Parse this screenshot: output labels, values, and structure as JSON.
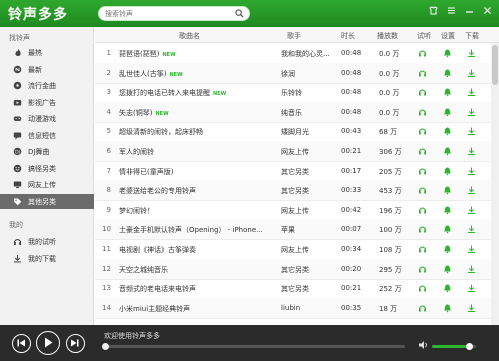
{
  "app": {
    "title": "铃声多多"
  },
  "search": {
    "placeholder": "搜索铃声"
  },
  "sidebar": {
    "section_find": "找铃声",
    "items": [
      {
        "label": "最热",
        "icon": "flame-icon"
      },
      {
        "label": "最新",
        "icon": "new-icon"
      },
      {
        "label": "流行金曲",
        "icon": "disc-icon"
      },
      {
        "label": "影视广告",
        "icon": "film-icon"
      },
      {
        "label": "动漫游戏",
        "icon": "gamepad-icon"
      },
      {
        "label": "信息短信",
        "icon": "message-icon"
      },
      {
        "label": "DJ舞曲",
        "icon": "dj-icon"
      },
      {
        "label": "搞怪另类",
        "icon": "funny-icon"
      },
      {
        "label": "网友上传",
        "icon": "upload-icon"
      },
      {
        "label": "其他另类",
        "icon": "tag-icon"
      }
    ],
    "active_index": 9,
    "section_mine": "我的",
    "mine_items": [
      {
        "label": "我的试听",
        "icon": "headphone-icon"
      },
      {
        "label": "我的下载",
        "icon": "download-icon"
      }
    ]
  },
  "table": {
    "headers": {
      "name": "歌曲名",
      "singer": "歌手",
      "duration": "时长",
      "plays": "播放数",
      "listen": "试听",
      "settings": "设置",
      "download": "下载"
    },
    "rows": [
      {
        "num": "1",
        "name": "琵琶语(琵琶)",
        "new": "NEW",
        "singer": "我和我的心灵...",
        "duration": "00:48",
        "plays": "0.0 万"
      },
      {
        "num": "2",
        "name": "乱世佳人(古筝)",
        "new": "NEW",
        "singer": "徐润",
        "duration": "00:48",
        "plays": "0.0 万"
      },
      {
        "num": "3",
        "name": "您拨打的电话已转入来电提醒",
        "new": "NEW",
        "singer": "乐铃铃",
        "duration": "00:48",
        "plays": "0.0 万"
      },
      {
        "num": "4",
        "name": "矢志(铜琴)",
        "new": "NEW",
        "singer": "纯音乐",
        "duration": "00:48",
        "plays": "0.0 万"
      },
      {
        "num": "5",
        "name": "超级清新的闹铃，起床舒畅",
        "new": "",
        "singer": "矮脚月光",
        "duration": "00:43",
        "plays": "68 万"
      },
      {
        "num": "6",
        "name": "军人的闹铃",
        "new": "",
        "singer": "网友上传",
        "duration": "00:21",
        "plays": "306 万"
      },
      {
        "num": "7",
        "name": "情非得已(童声版)",
        "new": "",
        "singer": "其它另类",
        "duration": "00:17",
        "plays": "205 万"
      },
      {
        "num": "8",
        "name": "老婆送给老公的专用铃声",
        "new": "",
        "singer": "其它另类",
        "duration": "00:33",
        "plays": "453 万"
      },
      {
        "num": "9",
        "name": "梦幻闹铃！",
        "new": "",
        "singer": "网友上传",
        "duration": "00:42",
        "plays": "196 万"
      },
      {
        "num": "10",
        "name": "土豪金手机默认铃声（Opening） - iPhone...",
        "new": "",
        "singer": "苹果",
        "duration": "00:07",
        "plays": "100 万"
      },
      {
        "num": "11",
        "name": "电视剧《神话》古筝弹奏",
        "new": "",
        "singer": "网友上传",
        "duration": "00:34",
        "plays": "108 万"
      },
      {
        "num": "12",
        "name": "天空之城纯音乐",
        "new": "",
        "singer": "其它另类",
        "duration": "00:20",
        "plays": "295 万"
      },
      {
        "num": "13",
        "name": "音频式的老电话来电铃声",
        "new": "",
        "singer": "其它另类",
        "duration": "00:21",
        "plays": "252 万"
      },
      {
        "num": "14",
        "name": "小米miui主题经典铃声",
        "new": "",
        "singer": "liubin",
        "duration": "00:35",
        "plays": "18 万"
      }
    ]
  },
  "player": {
    "welcome": "欢迎使用铃声多多",
    "progress": 0.0,
    "volume": 0.85
  },
  "colors": {
    "brand": "#2db52d",
    "titlebar": "#1f8a1f",
    "player_bg": "#2b2b2b",
    "sidebar_active": "#6b6b6b"
  }
}
